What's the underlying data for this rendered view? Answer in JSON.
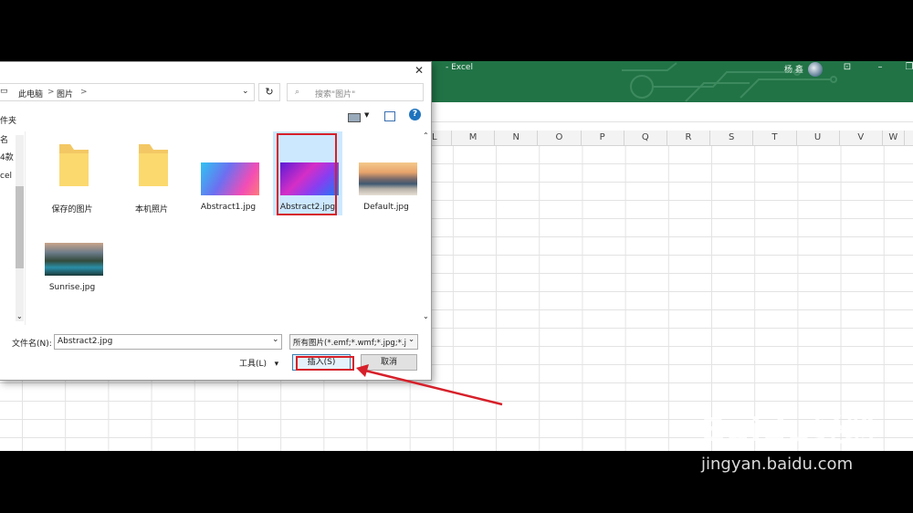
{
  "excel": {
    "app_title": "- Excel",
    "user_name": "杨 鑫",
    "columns": [
      "L",
      "M",
      "N",
      "O",
      "P",
      "Q",
      "R",
      "S",
      "T",
      "U",
      "V",
      "W"
    ],
    "accent": "#217346"
  },
  "dialog": {
    "close_symbol": "✕",
    "breadcrumb": [
      "此电脑",
      "图片"
    ],
    "breadcrumb_sep": ">",
    "search_placeholder": "搜索\"图片\"",
    "toolbar_left": "件夹",
    "nav_labels": [
      "名",
      "4款",
      "cel"
    ],
    "items": [
      {
        "caption": "保存的图片",
        "type": "folder"
      },
      {
        "caption": "本机照片",
        "type": "folder"
      },
      {
        "caption": "Abstract1.jpg",
        "type": "image"
      },
      {
        "caption": "Abstract2.jpg",
        "type": "image",
        "selected": true
      },
      {
        "caption": "Default.jpg",
        "type": "image"
      },
      {
        "caption": "Sunrise.jpg",
        "type": "image"
      }
    ],
    "filename_label": "文件名(N):",
    "filename_value": "Abstract2.jpg",
    "filetype_value": "所有图片(*.emf;*.wmf;*.jpg;*.j",
    "tools_label": "工具(L)",
    "insert_label": "插入(S)",
    "cancel_label": "取消",
    "highlight_color": "#d6202a",
    "selection_color": "#cce8ff"
  },
  "watermark": {
    "brand": "Baidu经验",
    "url": "jingyan.baidu.com"
  }
}
